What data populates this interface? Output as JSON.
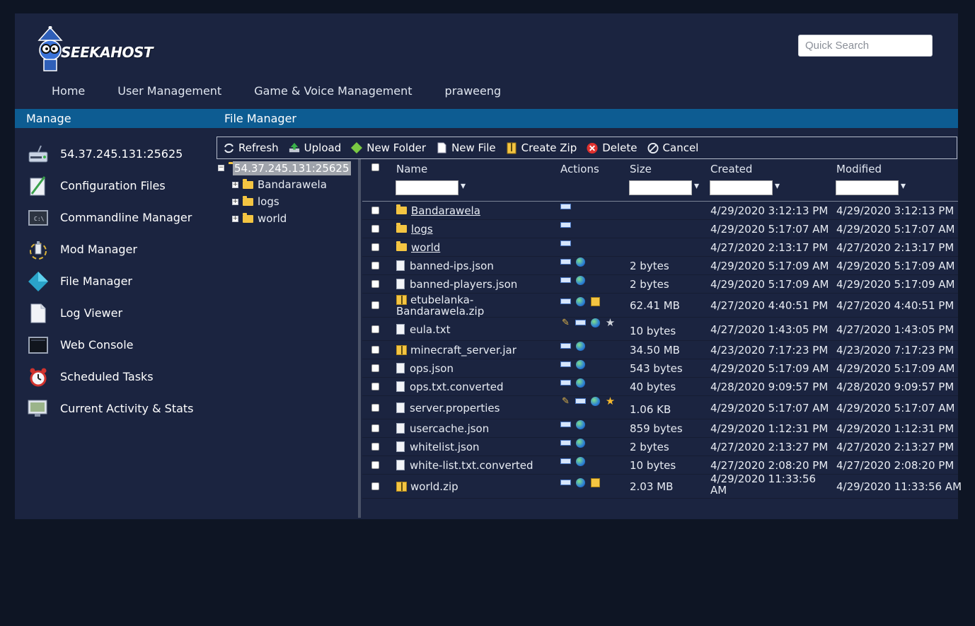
{
  "brand": {
    "logo_text": "SEEKAHOST"
  },
  "search": {
    "placeholder": "Quick Search"
  },
  "topnav": [
    "Home",
    "User Management",
    "Game & Voice Management",
    "praweeng"
  ],
  "bar": {
    "left": "Manage",
    "right": "File Manager"
  },
  "sidebar": {
    "items": [
      {
        "label": "54.37.245.131:25625",
        "icon": "server-icon"
      },
      {
        "label": "Configuration Files",
        "icon": "config-file-icon"
      },
      {
        "label": "Commandline Manager",
        "icon": "commandline-icon"
      },
      {
        "label": "Mod Manager",
        "icon": "mod-icon"
      },
      {
        "label": "File Manager",
        "icon": "file-manager-icon"
      },
      {
        "label": "Log Viewer",
        "icon": "log-icon"
      },
      {
        "label": "Web Console",
        "icon": "console-icon"
      },
      {
        "label": "Scheduled Tasks",
        "icon": "alarm-clock-icon"
      },
      {
        "label": "Current Activity & Stats",
        "icon": "stats-icon"
      }
    ]
  },
  "toolbar": {
    "refresh": "Refresh",
    "upload": "Upload",
    "new_folder": "New Folder",
    "new_file": "New File",
    "create_zip": "Create Zip",
    "delete": "Delete",
    "cancel": "Cancel"
  },
  "tree": {
    "root": "54.37.245.131:25625",
    "children": [
      "Bandarawela",
      "logs",
      "world"
    ]
  },
  "table": {
    "headers": {
      "name": "Name",
      "actions": "Actions",
      "size": "Size",
      "created": "Created",
      "modified": "Modified"
    },
    "rows": [
      {
        "name": "Bandarawela",
        "type": "folder",
        "actions": [
          "rename"
        ],
        "size": "",
        "created": "4/29/2020 3:12:13 PM",
        "modified": "4/29/2020 3:12:13 PM"
      },
      {
        "name": "logs",
        "type": "folder",
        "actions": [
          "rename"
        ],
        "size": "",
        "created": "4/29/2020 5:17:07 AM",
        "modified": "4/29/2020 5:17:07 AM"
      },
      {
        "name": "world",
        "type": "folder",
        "actions": [
          "rename"
        ],
        "size": "",
        "created": "4/27/2020 2:13:17 PM",
        "modified": "4/27/2020 2:13:17 PM"
      },
      {
        "name": "banned-ips.json",
        "type": "file",
        "actions": [
          "rename",
          "download"
        ],
        "size": "2 bytes",
        "created": "4/29/2020 5:17:09 AM",
        "modified": "4/29/2020 5:17:09 AM"
      },
      {
        "name": "banned-players.json",
        "type": "file",
        "actions": [
          "rename",
          "download"
        ],
        "size": "2 bytes",
        "created": "4/29/2020 5:17:09 AM",
        "modified": "4/29/2020 5:17:09 AM"
      },
      {
        "name": "etubelanka-Bandarawela.zip",
        "name_line1": "etubelanka-",
        "name_line2": "Bandarawela.zip",
        "type": "zip",
        "actions": [
          "rename",
          "download",
          "extract"
        ],
        "size": "62.41 MB",
        "created": "4/27/2020 4:40:51 PM",
        "modified": "4/27/2020 4:40:51 PM"
      },
      {
        "name": "eula.txt",
        "type": "file",
        "actions": [
          "edit",
          "rename",
          "download",
          "star-grey"
        ],
        "size": "10 bytes",
        "created": "4/27/2020 1:43:05 PM",
        "modified": "4/27/2020 1:43:05 PM"
      },
      {
        "name": "minecraft_server.jar",
        "type": "zip",
        "actions": [
          "rename",
          "download"
        ],
        "size": "34.50 MB",
        "created": "4/23/2020 7:17:23 PM",
        "modified": "4/23/2020 7:17:23 PM"
      },
      {
        "name": "ops.json",
        "type": "file",
        "actions": [
          "rename",
          "download"
        ],
        "size": "543 bytes",
        "created": "4/29/2020 5:17:09 AM",
        "modified": "4/29/2020 5:17:09 AM"
      },
      {
        "name": "ops.txt.converted",
        "type": "file",
        "actions": [
          "rename",
          "download"
        ],
        "size": "40 bytes",
        "created": "4/28/2020 9:09:57 PM",
        "modified": "4/28/2020 9:09:57 PM"
      },
      {
        "name": "server.properties",
        "type": "file",
        "actions": [
          "edit",
          "rename",
          "download",
          "star-gold"
        ],
        "size": "1.06 KB",
        "created": "4/29/2020 5:17:07 AM",
        "modified": "4/29/2020 5:17:07 AM"
      },
      {
        "name": "usercache.json",
        "type": "file",
        "actions": [
          "rename",
          "download"
        ],
        "size": "859 bytes",
        "created": "4/29/2020 1:12:31 PM",
        "modified": "4/29/2020 1:12:31 PM"
      },
      {
        "name": "whitelist.json",
        "type": "file",
        "actions": [
          "rename",
          "download"
        ],
        "size": "2 bytes",
        "created": "4/27/2020 2:13:27 PM",
        "modified": "4/27/2020 2:13:27 PM"
      },
      {
        "name": "white-list.txt.converted",
        "type": "file",
        "actions": [
          "rename",
          "download"
        ],
        "size": "10 bytes",
        "created": "4/27/2020 2:08:20 PM",
        "modified": "4/27/2020 2:08:20 PM"
      },
      {
        "name": "world.zip",
        "type": "zip",
        "actions": [
          "rename",
          "download",
          "extract"
        ],
        "size": "2.03 MB",
        "created": "4/29/2020 11:33:56 AM",
        "created_line1": "4/29/2020 11:33:56",
        "created_line2": "AM",
        "modified": "4/29/2020 11:33:56 AM"
      }
    ]
  },
  "colors": {
    "page_bg": "#0e1524",
    "panel_bg": "#1b2440",
    "bar_blue": "#0d5c92",
    "tree_selected": "#9fa3ab"
  }
}
